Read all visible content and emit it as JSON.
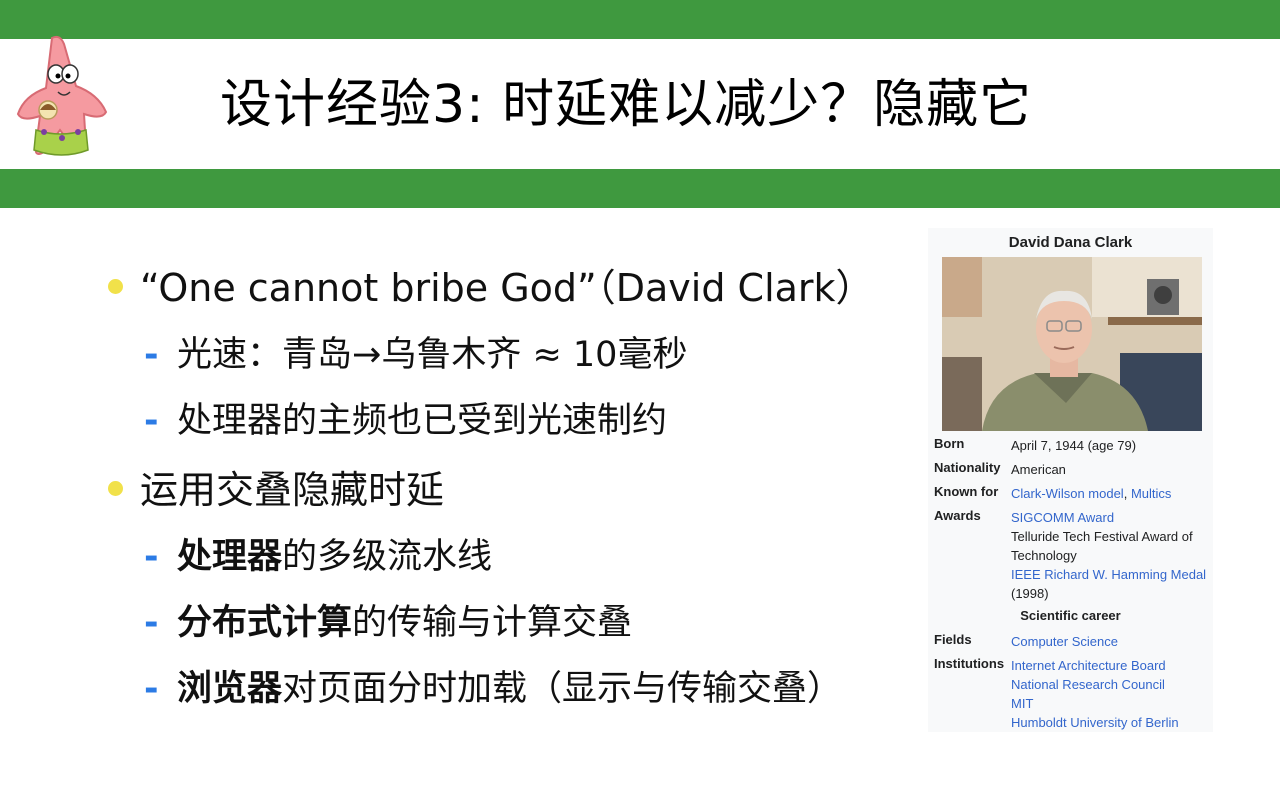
{
  "slide": {
    "title": "设计经验3: 时延难以减少？隐藏它",
    "mascot_icon": "patrick-star-icon",
    "accent_bar_color": "#3f993f",
    "bullet_color": "#f1e14a",
    "dash_color": "#2c7be5"
  },
  "bullets": [
    {
      "text": "“One cannot bribe God”（David Clark）",
      "subs": [
        {
          "bold": "",
          "text": "光速：青岛→乌鲁木齐  ≈ 10毫秒"
        },
        {
          "bold": "",
          "text": "处理器的主频也已受到光速制约"
        }
      ]
    },
    {
      "text": "运用交叠隐藏时延",
      "subs": [
        {
          "bold": "处理器",
          "text": "的多级流水线"
        },
        {
          "bold": "分布式计算",
          "text": "的传输与计算交叠"
        },
        {
          "bold": "浏览器",
          "text": "对页面分时加载（显示与传输交叠）"
        }
      ]
    }
  ],
  "dash": "-",
  "infobox": {
    "name": "David Dana Clark",
    "photo_icon": "portrait-photo-icon",
    "born_label": "Born",
    "born_value": "April 7, 1944 (age 79)",
    "nationality_label": "Nationality",
    "nationality_value": "American",
    "known_label": "Known for",
    "known_link1": "Clark-Wilson model",
    "known_sep": ", ",
    "known_link2": "Multics",
    "awards_label": "Awards",
    "award1": "SIGCOMM Award",
    "award2": "Telluride Tech Festival Award of Technology",
    "award3": "IEEE Richard W. Hamming Medal",
    "award3_suffix": " (1998)",
    "career_heading": "Scientific career",
    "fields_label": "Fields",
    "fields_value": "Computer Science",
    "institutions_label": "Institutions",
    "institutions": [
      "Internet Architecture Board",
      "National Research Council",
      "MIT",
      "Humboldt University of Berlin"
    ]
  }
}
